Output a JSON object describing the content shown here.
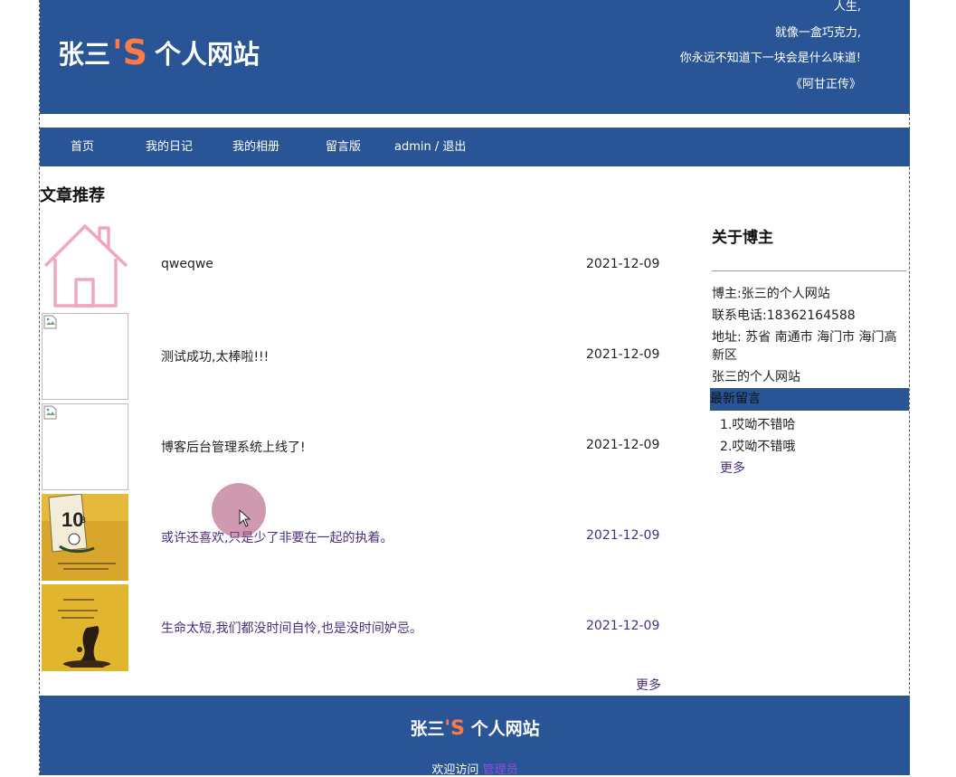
{
  "header": {
    "logo": {
      "name": "张三",
      "apostrophe": "'S",
      "rest": "个人网站"
    },
    "quote": [
      "人生,",
      "就像一盒巧克力,",
      "你永远不知道下一块会是什么味道!",
      "《阿甘正传》"
    ]
  },
  "nav": {
    "items": [
      {
        "label": "首页"
      },
      {
        "label": "我的日记"
      },
      {
        "label": "我的相册"
      },
      {
        "label": "留言版"
      },
      {
        "label": "admin / 退出"
      }
    ]
  },
  "articles": {
    "title": "文章推荐",
    "items": [
      {
        "thumb": "house-icon",
        "title": "qweqwe",
        "date": "2021-12-09"
      },
      {
        "thumb": "broken-image-icon",
        "title": "测试成功,太棒啦!!!",
        "date": "2021-12-09"
      },
      {
        "thumb": "broken-image-icon",
        "title": "博客后台管理系统上线了!",
        "date": "2021-12-09"
      },
      {
        "thumb": "photo-book-cover",
        "title": "或许还喜欢,只是少了非要在一起的执着。",
        "date": "2021-12-09"
      },
      {
        "thumb": "photo-yellow-tree",
        "title": "生命太短,我们都没时间自怜,也是没时间妒忌。",
        "date": "2021-12-09"
      }
    ],
    "more": "更多"
  },
  "sidebar": {
    "about_title": "关于博主",
    "blogger": "博主:张三的个人网站",
    "phone": "联系电话:18362164588",
    "address": "地址: 苏省 南通市 海门市 海门高新区",
    "site_name": "张三的个人网站",
    "messages_title": "最新留言",
    "messages": [
      "1.哎呦不错哈",
      "2.哎呦不错哦"
    ],
    "messages_more": "更多"
  },
  "footer": {
    "logo": {
      "name": "张三",
      "apostrophe": "'S",
      "rest": "个人网站"
    },
    "welcome": "欢迎访问",
    "admin_link": "管理员"
  },
  "colors": {
    "brand_blue": "#295597",
    "accent_orange": "#ff7a45",
    "visited_purple": "#4b2e7f"
  }
}
